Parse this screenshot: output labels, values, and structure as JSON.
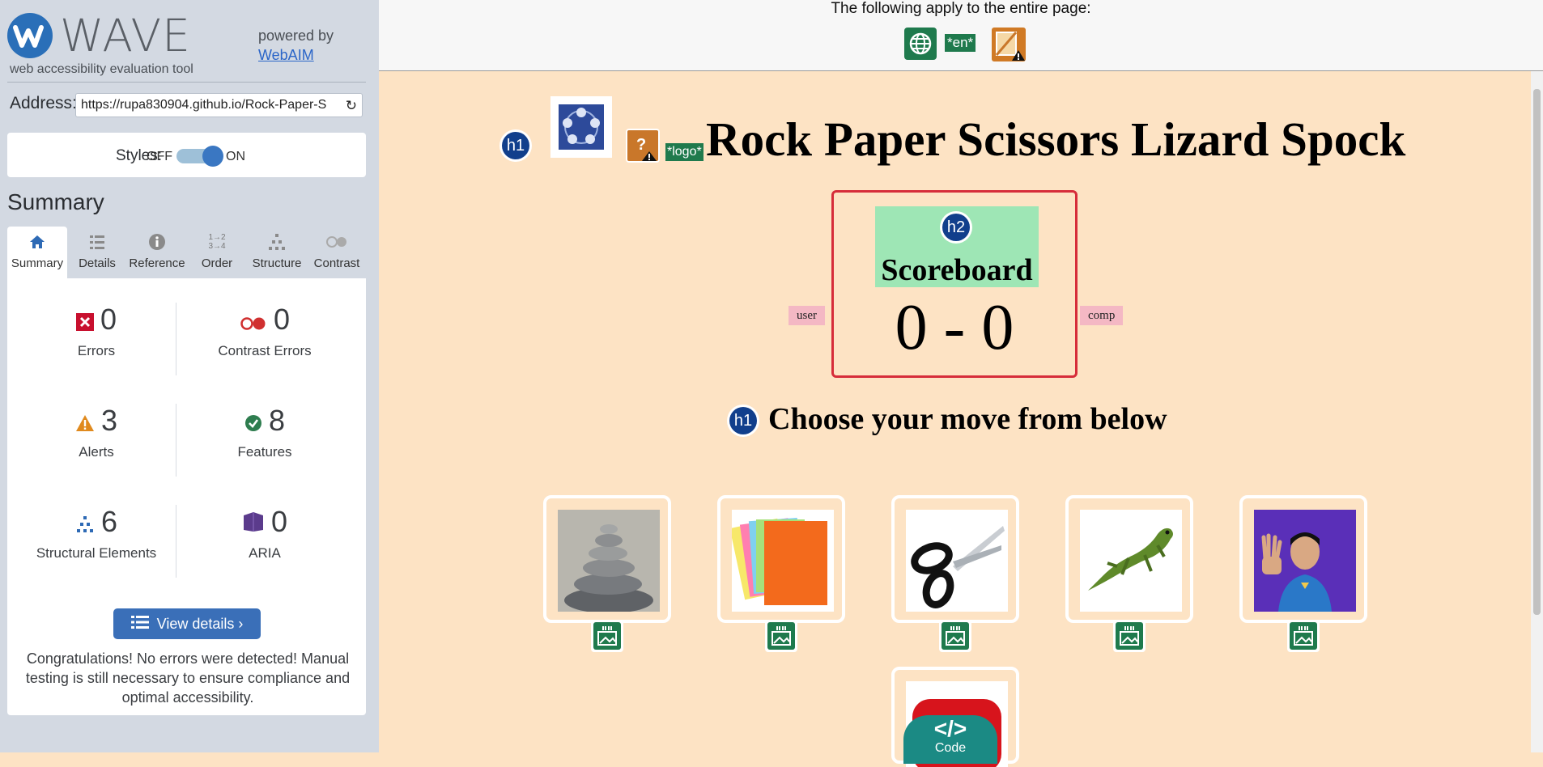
{
  "sidebar": {
    "brand": "WAVE",
    "subtitle": "web accessibility evaluation tool",
    "powered_by": "powered by",
    "webaim_link": "WebAIM",
    "address_label": "Address:",
    "address_value": "https://rupa830904.github.io/Rock-Paper-S",
    "styles_label": "Styles:",
    "styles_off": "OFF",
    "styles_on": "ON",
    "summary_title": "Summary",
    "tabs": [
      {
        "label": "Summary",
        "icon": "home-icon"
      },
      {
        "label": "Details",
        "icon": "list-icon"
      },
      {
        "label": "Reference",
        "icon": "info-icon"
      },
      {
        "label": "Order",
        "icon": "order-icon"
      },
      {
        "label": "Structure",
        "icon": "structure-icon"
      },
      {
        "label": "Contrast",
        "icon": "contrast-icon"
      }
    ],
    "stats": {
      "errors": {
        "count": "0",
        "label": "Errors",
        "color": "#c8102e"
      },
      "contrast_errors": {
        "count": "0",
        "label": "Contrast Errors",
        "color": "#d03030"
      },
      "alerts": {
        "count": "3",
        "label": "Alerts",
        "color": "#e08a1e"
      },
      "features": {
        "count": "8",
        "label": "Features",
        "color": "#2e7d4f"
      },
      "structural": {
        "count": "6",
        "label": "Structural Elements",
        "color": "#2e6ab5"
      },
      "aria": {
        "count": "0",
        "label": "ARIA",
        "color": "#5b3b8c"
      }
    },
    "view_details": "View details ›",
    "congrats": "Congratulations! No errors were detected! Manual testing is still necessary to ensure compliance and optimal accessibility."
  },
  "topbar": {
    "apply_text": "The following apply to the entire page:",
    "lang_tag": "*en*"
  },
  "page": {
    "h1_badge": "h1",
    "h2_badge": "h2",
    "logo_tag": "*logo*",
    "title": "Rock Paper Scissors Lizard Spock",
    "scoreboard_title": "Scoreboard",
    "score": "0 - 0",
    "user_tag": "user",
    "comp_tag": "comp",
    "choose_heading": "Choose your move from below",
    "moves": [
      "rock",
      "paper",
      "scissors",
      "lizard",
      "spock"
    ],
    "code_button": "Code"
  }
}
